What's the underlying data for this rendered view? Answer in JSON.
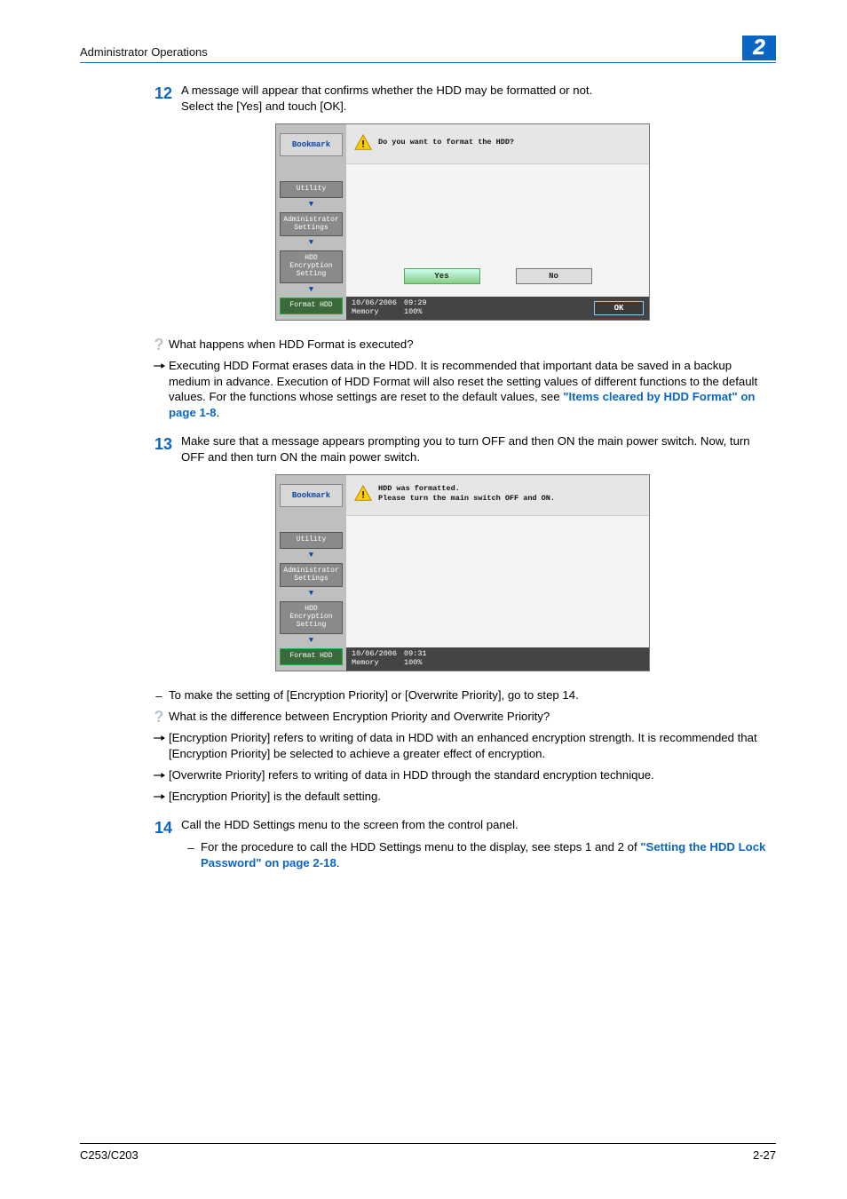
{
  "header": {
    "title": "Administrator Operations",
    "chapter": "2"
  },
  "step12": {
    "num": "12",
    "text1": "A message will appear that confirms whether the HDD may be formatted or not.",
    "text2": "Select the [Yes] and touch [OK]."
  },
  "screenshot1": {
    "bookmark": "Bookmark",
    "nav": {
      "utility": "Utility",
      "admin": "Administrator Settings",
      "hddenc": "HDD Encryption Setting",
      "format": "Format HDD"
    },
    "message": "Do you want to format the HDD?",
    "yes": "Yes",
    "no": "No",
    "date": "10/06/2006",
    "time": "09:29",
    "memlabel": "Memory",
    "mem": "100%",
    "ok": "OK"
  },
  "notes12": {
    "q": "What happens when HDD Format is executed?",
    "a": "Executing HDD Format erases data in the HDD. It is recommended that important data be saved in a backup medium in advance. Execution of HDD Format will also reset the setting values of different functions to the default values. For the functions whose settings are reset to the default values, see ",
    "link": "\"Items cleared by HDD Format\" on page 1-8",
    "end": "."
  },
  "step13": {
    "num": "13",
    "text": "Make sure that a message appears prompting you to turn OFF and then ON the main power switch. Now, turn OFF and then turn ON the main power switch."
  },
  "screenshot2": {
    "message1": "HDD was formatted.",
    "message2": "Please turn the main switch OFF and ON.",
    "date": "10/06/2006",
    "time": "09:31",
    "memlabel": "Memory",
    "mem": "100%"
  },
  "notes13": {
    "d1": "To make the setting of [Encryption Priority] or [Overwrite Priority], go to step 14.",
    "q": "What is the difference between Encryption Priority and Overwrite Priority?",
    "a1": "[Encryption Priority] refers to writing of data in HDD with an enhanced encryption strength. It is recommended that [Encryption Priority] be selected to achieve a greater effect of encryption.",
    "a2": "[Overwrite Priority] refers to writing of data in HDD through the standard encryption technique.",
    "a3": "[Encryption Priority] is the default setting."
  },
  "step14": {
    "num": "14",
    "text": "Call the HDD Settings menu to the screen from the control panel.",
    "d1a": "For the procedure to call the HDD Settings menu to the display, see steps 1 and 2 of ",
    "link": "\"Setting the HDD Lock Password\" on page 2-18",
    "d1b": "."
  },
  "footer": {
    "model": "C253/C203",
    "page": "2-27"
  }
}
